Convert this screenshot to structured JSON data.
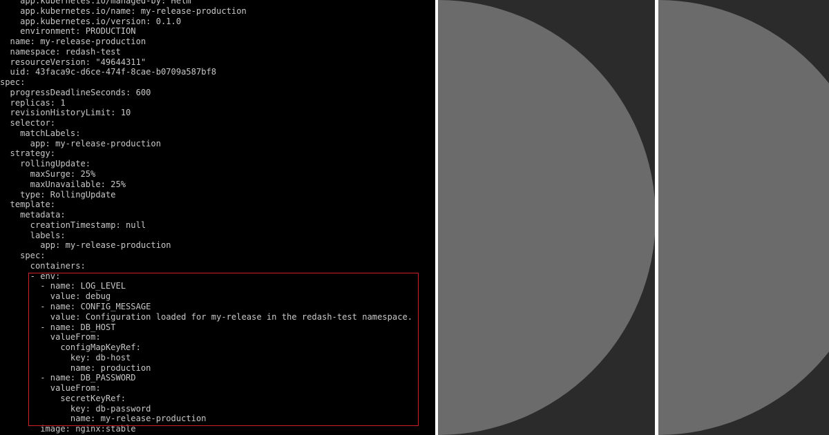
{
  "terminal": {
    "lines": [
      "    app.kubernetes.io/managed-by: Helm",
      "    app.kubernetes.io/name: my-release-production",
      "    app.kubernetes.io/version: 0.1.0",
      "    environment: PRODUCTION",
      "  name: my-release-production",
      "  namespace: redash-test",
      "  resourceVersion: \"49644311\"",
      "  uid: 43faca9c-d6ce-474f-8cae-b0709a587bf8",
      "spec:",
      "  progressDeadlineSeconds: 600",
      "  replicas: 1",
      "  revisionHistoryLimit: 10",
      "  selector:",
      "    matchLabels:",
      "      app: my-release-production",
      "  strategy:",
      "    rollingUpdate:",
      "      maxSurge: 25%",
      "      maxUnavailable: 25%",
      "    type: RollingUpdate",
      "  template:",
      "    metadata:",
      "      creationTimestamp: null",
      "      labels:",
      "        app: my-release-production",
      "    spec:",
      "      containers:",
      "      - env:",
      "        - name: LOG_LEVEL",
      "          value: debug",
      "        - name: CONFIG_MESSAGE",
      "          value: Configuration loaded for my-release in the redash-test namespace.",
      "        - name: DB_HOST",
      "          valueFrom:",
      "            configMapKeyRef:",
      "              key: db-host",
      "              name: production",
      "        - name: DB_PASSWORD",
      "          valueFrom:",
      "            secretKeyRef:",
      "              key: db-password",
      "              name: my-release-production",
      "        image: nginx:stable"
    ]
  },
  "colors": {
    "terminal_bg": "#000000",
    "terminal_text": "#c8c8c8",
    "highlight_border": "#d0202a",
    "panel_bg": "#2b2b2b",
    "circle_fill": "#6b6b6b",
    "divider": "#ffffff"
  }
}
